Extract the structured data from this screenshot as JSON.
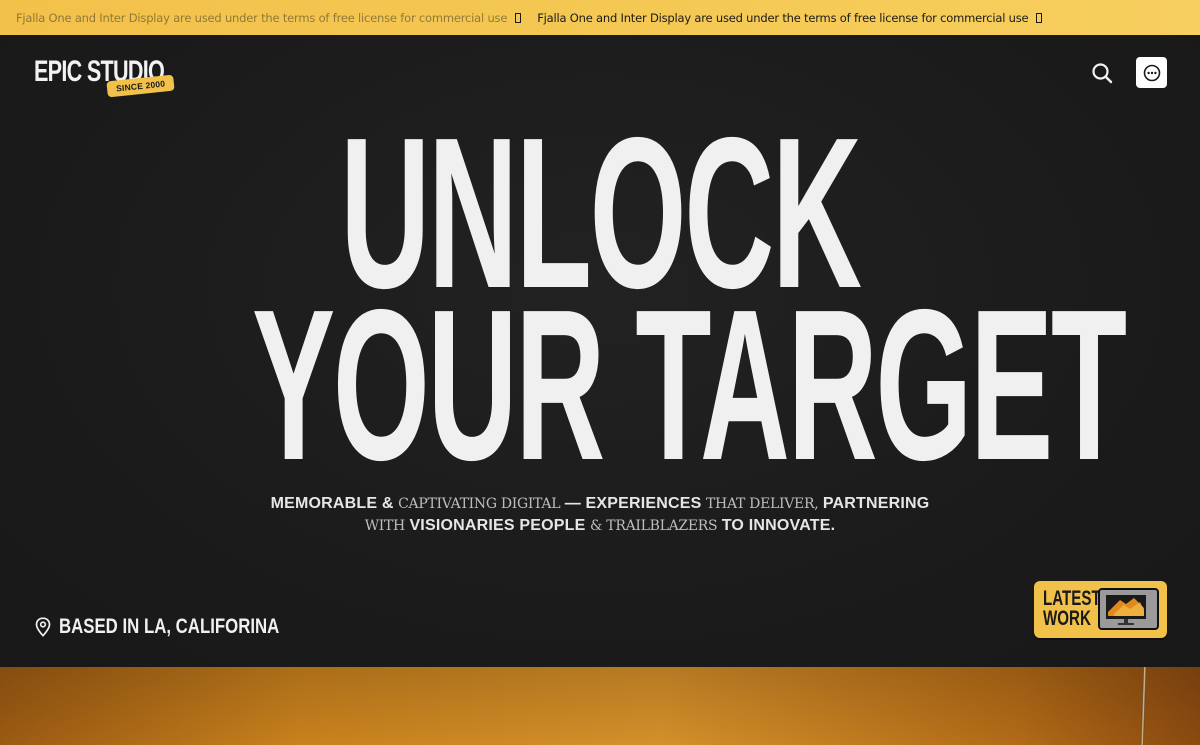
{
  "ticker": {
    "message_1": "Fjalla One and Inter Display are used under the terms of free license for commercial use",
    "message_2": "Fjalla One and Inter Display are used under the terms of free license for commercial use"
  },
  "header": {
    "logo_text": "EPIC STUDIO",
    "logo_badge": "SINCE 2000",
    "search_icon": "search-icon",
    "menu_icon": "more-dots-icon"
  },
  "hero": {
    "headline_line1": "UNLOCK",
    "headline_line2": "YOUR TARGET",
    "tagline": {
      "w1": "MEMORABLE &",
      "w2": "CAPTIVATING DIGITAL",
      "w3": "— EXPERIENCES",
      "w4": "THAT DELIVER,",
      "w5": "PARTNERING",
      "w6": "WITH",
      "w7": "VISIONARIES PEOPLE",
      "w8": "& TRAILBLAZERS",
      "w9": "TO INNOVATE."
    },
    "location_icon": "map-pin-icon",
    "location": "BASED IN LA, CALIFORINA",
    "latest_work_line1": "LATEST",
    "latest_work_line2": "WORK"
  },
  "colors": {
    "accent": "#f2c14a",
    "background": "#1c1c1c",
    "text": "#f0f0f0"
  }
}
